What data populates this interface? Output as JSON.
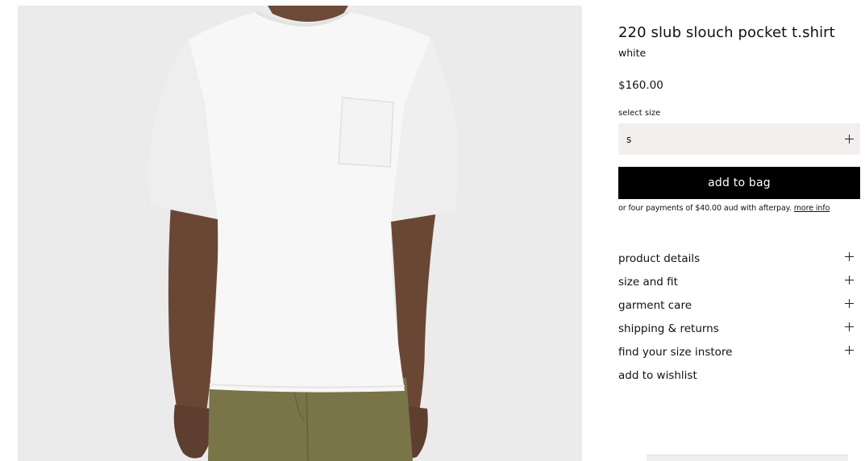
{
  "product": {
    "title": "220 slub slouch pocket t.shirt",
    "colour": "white",
    "price": "$160.00",
    "image_description_icon": "product-photo"
  },
  "size_select": {
    "label": "select size",
    "value": "s",
    "icon": "plus-icon"
  },
  "actions": {
    "add_to_bag": "add to bag",
    "afterpay_text": "or four payments of $40.00 aud with afterpay.",
    "afterpay_link": "more info",
    "wishlist": "add to wishlist"
  },
  "accordion": [
    {
      "label": "product details",
      "icon": "plus-icon"
    },
    {
      "label": "size and fit",
      "icon": "plus-icon"
    },
    {
      "label": "garment care",
      "icon": "plus-icon"
    },
    {
      "label": "shipping & returns",
      "icon": "plus-icon"
    },
    {
      "label": "find your size instore",
      "icon": "plus-icon"
    }
  ],
  "colors": {
    "button_bg": "#000000",
    "select_bg": "#f2efee",
    "image_bg": "#ebebeb"
  }
}
